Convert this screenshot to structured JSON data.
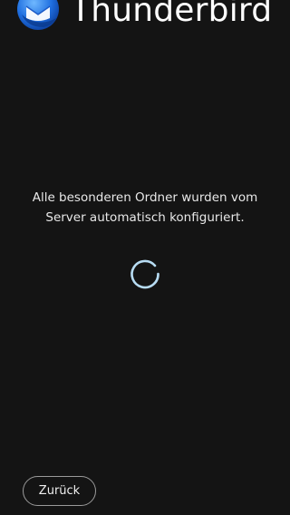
{
  "header": {
    "logo_icon": "thunderbird-logo-icon",
    "title": "Thunderbird"
  },
  "main": {
    "status_message": "Alle besonderen Ordner wurden vom\nServer automatisch konfiguriert.",
    "spinner_icon": "loading-spinner-icon"
  },
  "footer": {
    "back_label": "Zurück"
  },
  "colors": {
    "background": "#141414",
    "text": "#e8e8e8",
    "spinner": "#b7dcf3",
    "button_border": "#9a9a9a",
    "logo_blue": "#1a73e8"
  }
}
